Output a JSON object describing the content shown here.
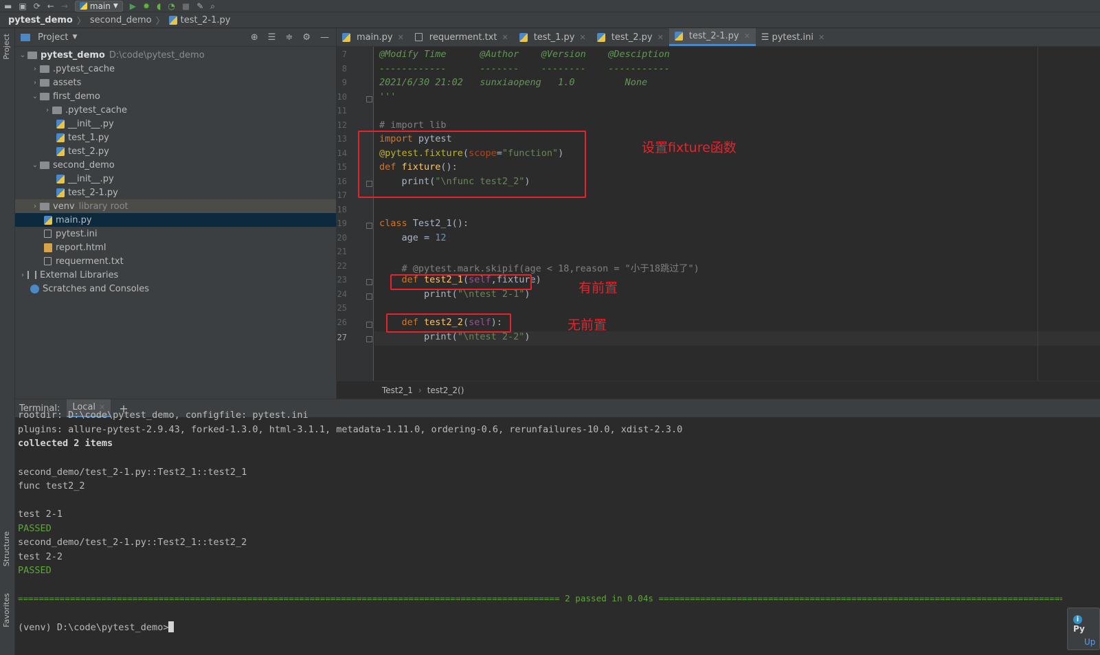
{
  "toolbar": {
    "run_config": "main"
  },
  "breadcrumb": [
    "pytest_demo",
    "second_demo",
    "test_2-1.py"
  ],
  "left_stripe": {
    "project": "Project",
    "structure": "Structure",
    "favorites": "Favorites"
  },
  "project_panel": {
    "title": "Project",
    "root": {
      "name": "pytest_demo",
      "path": "D:\\code\\pytest_demo"
    },
    "items": [
      {
        "label": ".pytest_cache"
      },
      {
        "label": "assets"
      },
      {
        "label": "first_demo"
      },
      {
        "label": ".pytest_cache"
      },
      {
        "label": "__init__.py"
      },
      {
        "label": "test_1.py"
      },
      {
        "label": "test_2.py"
      },
      {
        "label": "second_demo"
      },
      {
        "label": "__init__.py"
      },
      {
        "label": "test_2-1.py"
      },
      {
        "label": "venv",
        "hint": "library root"
      },
      {
        "label": "main.py"
      },
      {
        "label": "pytest.ini"
      },
      {
        "label": "report.html"
      },
      {
        "label": "requerment.txt"
      },
      {
        "label": "External Libraries"
      },
      {
        "label": "Scratches and Consoles"
      }
    ]
  },
  "editor_tabs": [
    "main.py",
    "requerment.txt",
    "test_1.py",
    "test_2.py",
    "test_2-1.py",
    "pytest.ini"
  ],
  "line_numbers": [
    "7",
    "8",
    "9",
    "10",
    "11",
    "12",
    "13",
    "14",
    "15",
    "16",
    "17",
    "18",
    "19",
    "20",
    "21",
    "22",
    "23",
    "24",
    "25",
    "26",
    "27"
  ],
  "code": {
    "l7": {
      "a": "@Modify Time",
      "b": "@Author",
      "c": "@Version",
      "d": "@Desciption"
    },
    "l8": {
      "a": "------------",
      "b": "-------",
      "c": "--------",
      "d": "-----------"
    },
    "l9": {
      "a": "2021/6/30 21:02",
      "b": "sunxiaopeng",
      "c": "1.0",
      "d": "None"
    },
    "l10": "'''",
    "l12": "# import lib",
    "l13": {
      "kw": "import",
      "rest": " pytest"
    },
    "l14": {
      "deco": "@pytest.fixture",
      "open": "(",
      "param": "scope",
      "eq": "=",
      "str": "\"function\"",
      "close": ")"
    },
    "l15": {
      "kw": "def",
      "fn": " fixture",
      "rest": "():"
    },
    "l16": {
      "indent": "    ",
      "call": "print",
      "open": "(",
      "str": "\"\\nfunc test2_2\"",
      "close": ")"
    },
    "l19": {
      "kw": "class",
      "rest": " Test2_1():"
    },
    "l20": {
      "indent": "    ",
      "name": "age = ",
      "num": "12"
    },
    "l22": "    # @pytest.mark.skipif(age < 18,reason = \"小于18跳过了\")",
    "l23": {
      "indent": "    ",
      "kw": "def",
      "fn": " test2_1",
      "open": "(",
      "self": "self",
      "rest": ",fixture)"
    },
    "l24": {
      "indent": "        ",
      "call": "print",
      "open": "(",
      "str": "\"\\ntest 2-1\"",
      "close": ")"
    },
    "l26": {
      "indent": "    ",
      "kw": "def",
      "fn": " test2_2",
      "open": "(",
      "self": "self",
      "rest": "):"
    },
    "l27": {
      "indent": "        ",
      "call": "print",
      "open": "(",
      "str": "\"\\ntest 2-2\"",
      "close": ")"
    }
  },
  "annotations": {
    "fixture_box": "设置fixture函数",
    "with_setup": "有前置",
    "without_setup": "无前置"
  },
  "editor_breadcrumb": [
    "Test2_1",
    "test2_2()"
  ],
  "terminal": {
    "label": "Terminal:",
    "tab": "Local",
    "lines": [
      "rootdir: D:\\code\\pytest_demo, configfile: pytest.ini",
      "plugins: allure-pytest-2.9.43, forked-1.3.0, html-3.1.1, metadata-1.11.0, ordering-0.6, rerunfailures-10.0, xdist-2.3.0",
      "collected 2 items",
      "",
      "second_demo/test_2-1.py::Test2_1::test2_1",
      "func test2_2",
      "",
      "test 2-1",
      "PASSED",
      "second_demo/test_2-1.py::Test2_1::test2_2",
      "test 2-2",
      "PASSED",
      "",
      "======================================================================================================== 2 passed in 0.04s ===================================================================================================================",
      "",
      "(venv) D:\\code\\pytest_demo>"
    ]
  },
  "notification": {
    "title": "Py",
    "link": "Up"
  },
  "colors": {
    "accent": "#4a88c7",
    "annotation_red": "#e8232b",
    "passed_green": "#5fa63b"
  }
}
